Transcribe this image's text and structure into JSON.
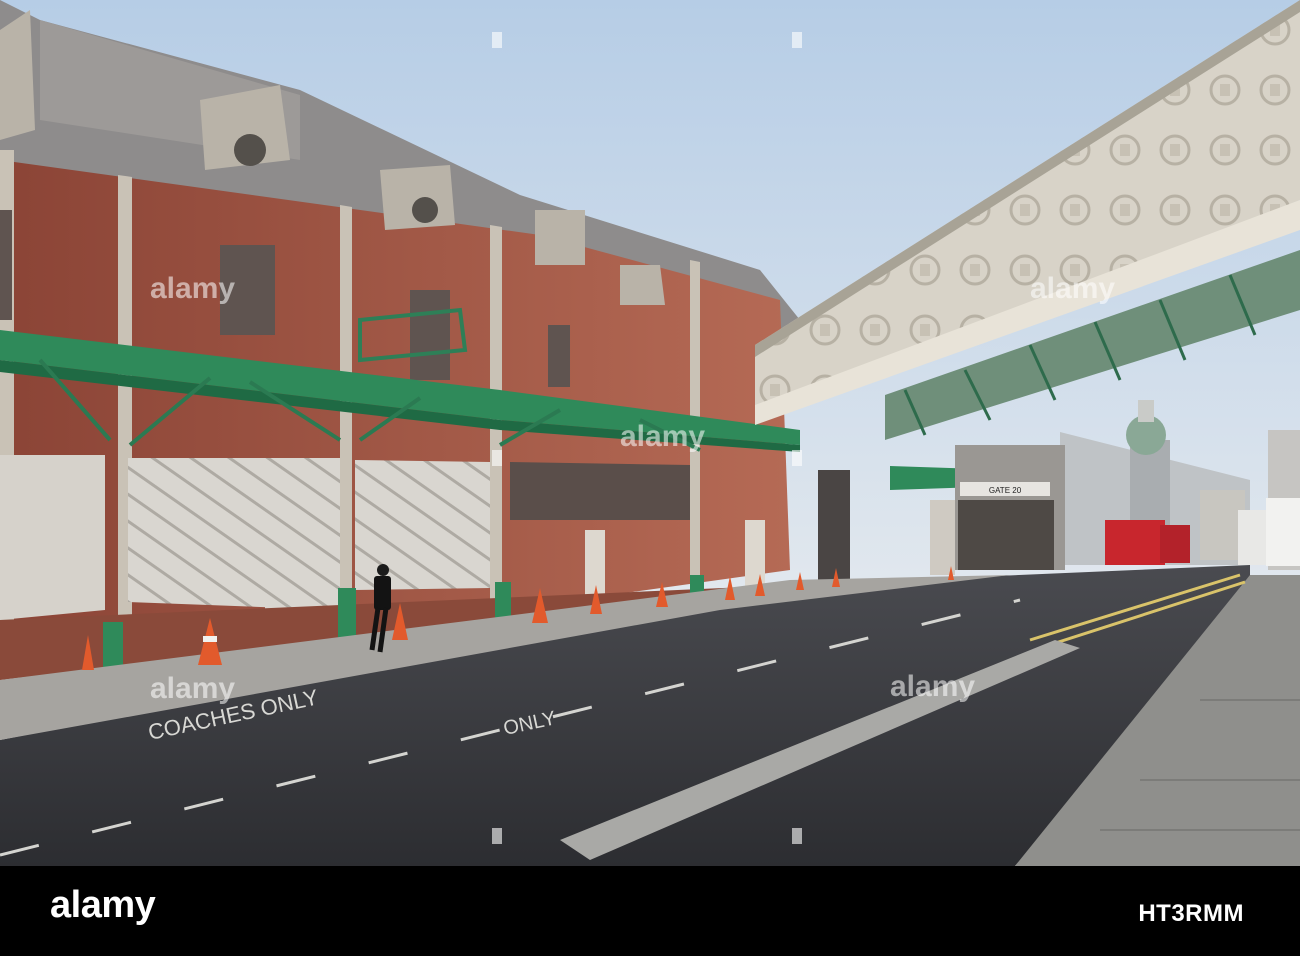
{
  "photo": {
    "signs": {
      "gate": "GATE 20"
    },
    "road_markings": {
      "coaches_only": "COACHES ONLY",
      "only": "ONLY"
    },
    "colors": {
      "sky": "#c8d9ec",
      "brick": "#9a5040",
      "canopy_green": "#2f8a5a",
      "road": "#3a3b3f"
    }
  },
  "watermark": {
    "text": "alamy"
  },
  "footer": {
    "logo": "alamy",
    "image_code": "HT3RMM"
  }
}
